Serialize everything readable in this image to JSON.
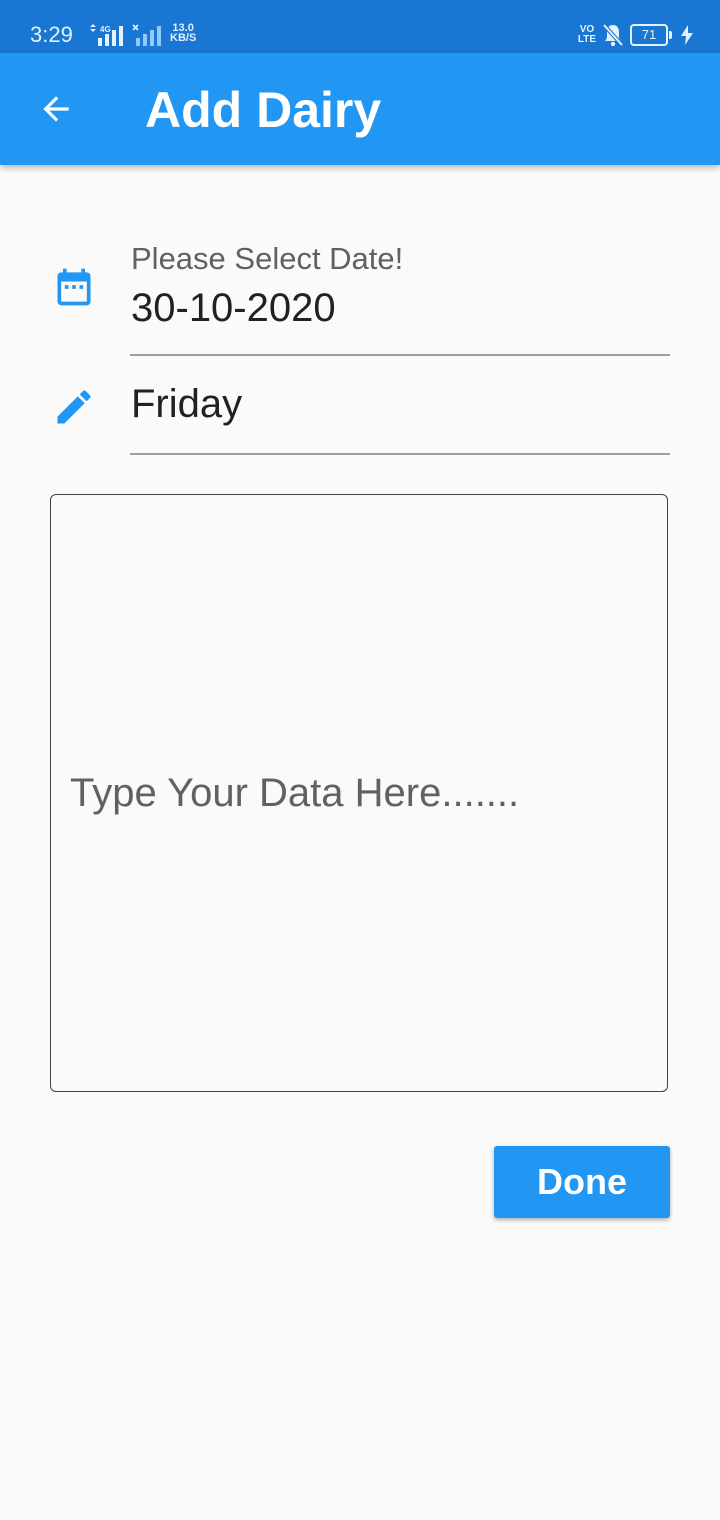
{
  "status_bar": {
    "time": "3:29",
    "network_type": "4G",
    "speed_value": "13.0",
    "speed_unit": "KB/S",
    "volte_top": "VO",
    "volte_bottom": "LTE",
    "battery_level": "71",
    "icons": [
      "data-arrows-icon",
      "signal-icon",
      "signal-icon",
      "volte-icon",
      "bell-off-icon",
      "battery-icon",
      "charging-bolt-icon"
    ]
  },
  "app_bar": {
    "title": "Add Dairy",
    "back_icon": "arrow-back-icon",
    "background_color": "#2196f3"
  },
  "form": {
    "date": {
      "icon": "calendar-icon",
      "label": "Please Select Date!",
      "value": "30-10-2020"
    },
    "day": {
      "icon": "pencil-icon",
      "value": "Friday"
    },
    "notes": {
      "placeholder": "Type Your Data Here......."
    },
    "submit": {
      "label": "Done"
    }
  },
  "colors": {
    "accent": "#2196f3",
    "status_bar": "#1976d2",
    "background": "#fafafa"
  }
}
